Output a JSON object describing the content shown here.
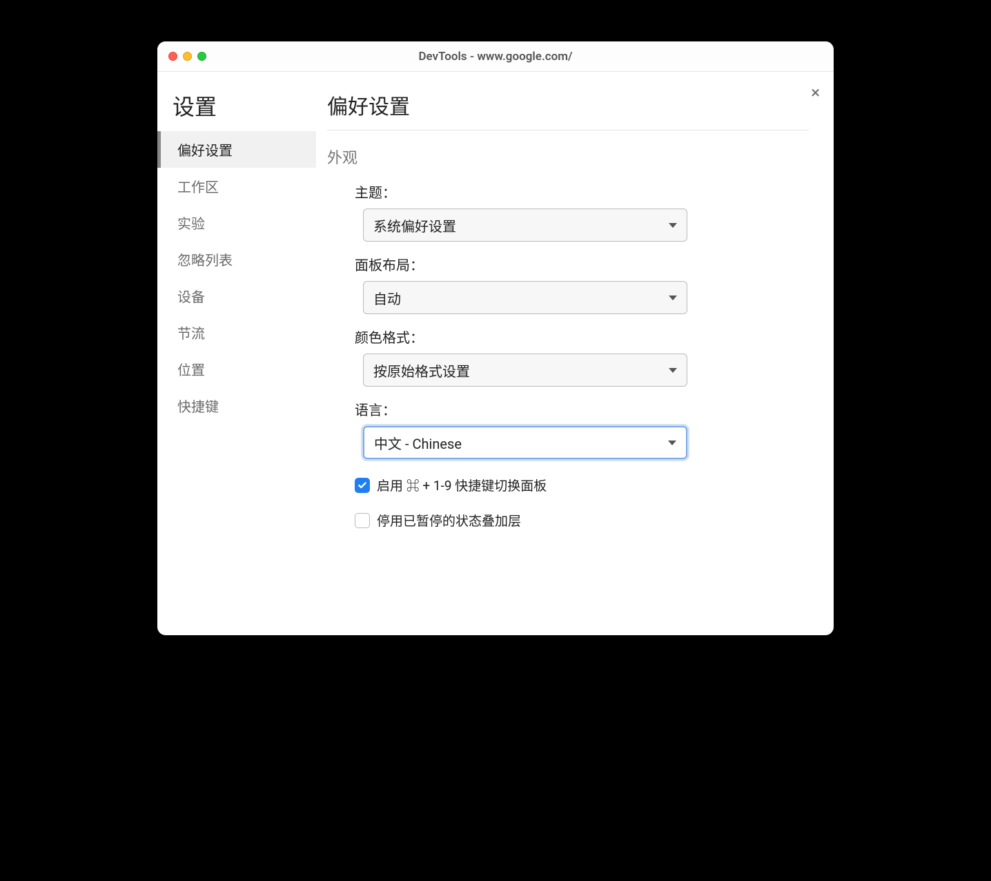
{
  "window": {
    "title": "DevTools - www.google.com/"
  },
  "close_label": "×",
  "sidebar": {
    "title": "设置",
    "items": [
      {
        "label": "偏好设置",
        "active": true
      },
      {
        "label": "工作区",
        "active": false
      },
      {
        "label": "实验",
        "active": false
      },
      {
        "label": "忽略列表",
        "active": false
      },
      {
        "label": "设备",
        "active": false
      },
      {
        "label": "节流",
        "active": false
      },
      {
        "label": "位置",
        "active": false
      },
      {
        "label": "快捷键",
        "active": false
      }
    ]
  },
  "main": {
    "title": "偏好设置",
    "section_appearance": "外观",
    "theme": {
      "label": "主题：",
      "value": "系统偏好设置"
    },
    "panel_layout": {
      "label": "面板布局：",
      "value": "自动"
    },
    "color_format": {
      "label": "颜色格式：",
      "value": "按原始格式设置"
    },
    "language": {
      "label": "语言：",
      "value": "中文 - Chinese"
    },
    "checkbox_shortcut": {
      "checked": true,
      "label": "启用 ⌘ + 1-9 快捷键切换面板"
    },
    "checkbox_overlay": {
      "checked": false,
      "label": "停用已暂停的状态叠加层"
    }
  }
}
